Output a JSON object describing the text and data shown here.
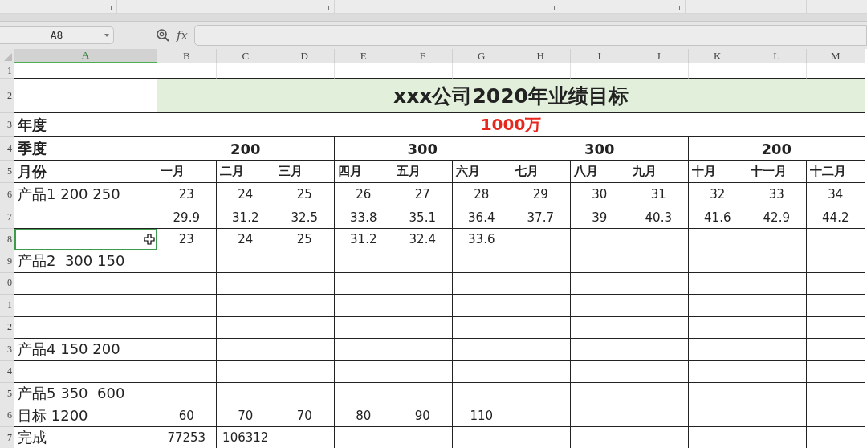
{
  "name_box": "A8",
  "formula_label": "fx",
  "columns": [
    {
      "label": "A",
      "selected": true
    },
    {
      "label": "B",
      "selected": false
    },
    {
      "label": "C",
      "selected": false
    },
    {
      "label": "D",
      "selected": false
    },
    {
      "label": "E",
      "selected": false
    },
    {
      "label": "F",
      "selected": false
    },
    {
      "label": "G",
      "selected": false
    },
    {
      "label": "H",
      "selected": false
    },
    {
      "label": "I",
      "selected": false
    },
    {
      "label": "J",
      "selected": false
    },
    {
      "label": "K",
      "selected": false
    },
    {
      "label": "L",
      "selected": false
    },
    {
      "label": "M",
      "selected": false
    }
  ],
  "row_numbers": [
    "1",
    "2",
    "3",
    "4",
    "5",
    "6",
    "7",
    "8",
    "9",
    "0",
    "1",
    "2",
    "3",
    "4",
    "5",
    "6",
    "7"
  ],
  "sheet": {
    "title": "xxx公司2020年业绩目标",
    "year": {
      "label": "年度",
      "value": "1000万"
    },
    "quarter": {
      "label": "季度",
      "values": [
        "200",
        "300",
        "300",
        "200"
      ]
    },
    "month": {
      "label": "月份",
      "values": [
        "一月",
        "二月",
        "三月",
        "四月",
        "五月",
        "六月",
        "七月",
        "八月",
        "九月",
        "十月",
        "十一月",
        "十二月"
      ]
    },
    "data_rows": [
      {
        "label": "产品1 200 250",
        "selected": false,
        "values": [
          "23",
          "24",
          "25",
          "26",
          "27",
          "28",
          "29",
          "30",
          "31",
          "32",
          "33",
          "34"
        ]
      },
      {
        "selected": false,
        "values": [
          "29.9",
          "31.2",
          "32.5",
          "33.8",
          "35.1",
          "36.4",
          "37.7",
          "39",
          "40.3",
          "41.6",
          "42.9",
          "44.2"
        ]
      },
      {
        "selected": true,
        "values": [
          "23",
          "24",
          "25",
          "31.2",
          "32.4",
          "33.6"
        ]
      },
      {
        "label": "产品2  300 150",
        "selected": false
      },
      {
        "selected": false
      },
      {
        "selected": false
      },
      {
        "selected": false
      },
      {
        "label": "产品4 150 200",
        "selected": false
      },
      {
        "selected": false
      },
      {
        "label": "产品5 350  600",
        "selected": false
      },
      {
        "label": "目标 1200",
        "selected": false,
        "values": [
          "60",
          "70",
          "70",
          "80",
          "90",
          "110"
        ]
      },
      {
        "label": "完成",
        "selected": false,
        "values": [
          "77253",
          "106312"
        ]
      }
    ]
  }
}
